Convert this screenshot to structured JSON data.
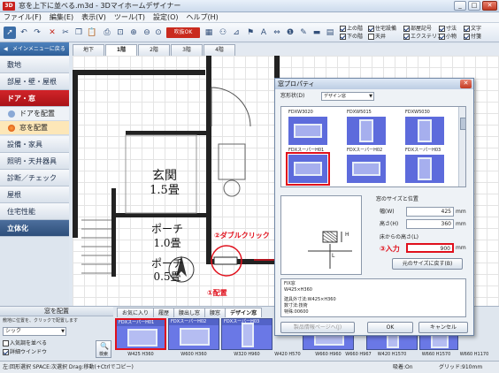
{
  "window": {
    "title": "窓を上下に並べる.m3d - 3Dマイホームデザイナー",
    "app_icon": "3D"
  },
  "menu": [
    "ファイル(F)",
    "編集(E)",
    "表示(V)",
    "ツール(T)",
    "設定(O)",
    "ヘルプ(H)"
  ],
  "toolbar": {
    "red_label": "吹抜OK",
    "checks": [
      {
        "label": "上の階",
        "on": true
      },
      {
        "label": "住宅設備",
        "on": true
      },
      {
        "label": "部屋記号",
        "on": true
      },
      {
        "label": "寸法",
        "on": true
      },
      {
        "label": "文字",
        "on": true
      },
      {
        "label": "下の階",
        "on": true
      },
      {
        "label": "天井",
        "on": false
      },
      {
        "label": "エクステリア",
        "on": true
      },
      {
        "label": "小物",
        "on": true
      },
      {
        "label": "付箋",
        "on": true
      }
    ]
  },
  "sidebar": {
    "back": "メインメニューに戻る",
    "categories": [
      "敷地",
      "部屋・壁・屋根",
      "ドア・窓",
      "設備・家具",
      "照明・天井器具",
      "診断／チェック",
      "屋根",
      "住宅性能",
      "立体化"
    ],
    "subitems": [
      "ドアを配置",
      "窓を配置"
    ]
  },
  "floor_tabs": [
    "地下",
    "1階",
    "2階",
    "3階",
    "4階"
  ],
  "plan": {
    "room1_name": "玄関",
    "room1_size": "1.5畳",
    "room2_name": "ポーチ",
    "room2_size": "1.0畳",
    "room3_name": "ポーチ",
    "room3_size": "0.5畳"
  },
  "annotations": {
    "double_click": "②ダブルクリック",
    "place": "①配置",
    "enter": "③入力"
  },
  "bottom_panel": {
    "title": "窓を配置",
    "help": "敷地に位置を、クリックで配置します",
    "select": "シック",
    "check_glass": "入気調を並べる",
    "check_detail": "詳細ウインドウ",
    "search": "検索",
    "tabs": [
      "お気に入り",
      "履歴",
      "腰出し窓",
      "腰窓",
      "デザイン窓"
    ],
    "thumbs": [
      {
        "label": "FDXスーパーH01",
        "cap": "W425 H360"
      },
      {
        "label": "FDXスーパーH02",
        "cap": "W600 H360"
      },
      {
        "label": "FDXスーパーH03",
        "cap": "W320 H960"
      },
      {
        "label": "",
        "cap": "W420 H570"
      },
      {
        "label": "",
        "cap": "W660 H960"
      },
      {
        "label": "",
        "cap": "W660 H967"
      },
      {
        "label": "",
        "cap": "W420 H1570"
      },
      {
        "label": "",
        "cap": "W660 H1570"
      },
      {
        "label": "",
        "cap": "W660 H1170"
      }
    ]
  },
  "dialog": {
    "title": "窓プロパティ",
    "shape_label": "窓形状(D)",
    "shape_value": "デザイン窓",
    "items": [
      {
        "name": "FDXW3020"
      },
      {
        "name": "FDXW5015"
      },
      {
        "name": "FDXW5030"
      },
      {
        "name": "FDXスーパーH01"
      },
      {
        "name": "FDXスーパーH02"
      },
      {
        "name": "FDXスーパーH03"
      }
    ],
    "size_section": "窓のサイズと位置",
    "width_label": "幅(W)",
    "width_value": "425",
    "unit": "mm",
    "height_label": "高さ(H)",
    "height_value": "360",
    "floor_height_label": "床からの高さ(L)",
    "floor_height_value": "900",
    "reset_button": "元のサイズに戻す(B)",
    "info_lines": [
      "FIX窓",
      "W425×H360",
      "建具外寸法:W425×H360",
      "数寸法:技術",
      "特殊:00600"
    ],
    "product_button": "製品情報ページへ(J)",
    "ok": "OK",
    "cancel": "キャンセル",
    "preview_h": "H",
    "preview_l": "L"
  },
  "status": {
    "left": "左:回形選択 SPACE:次選択 Drag:移動(+Ctrlでコピー)",
    "snap": "吸着:On",
    "grid": "グリッド:910mm"
  }
}
